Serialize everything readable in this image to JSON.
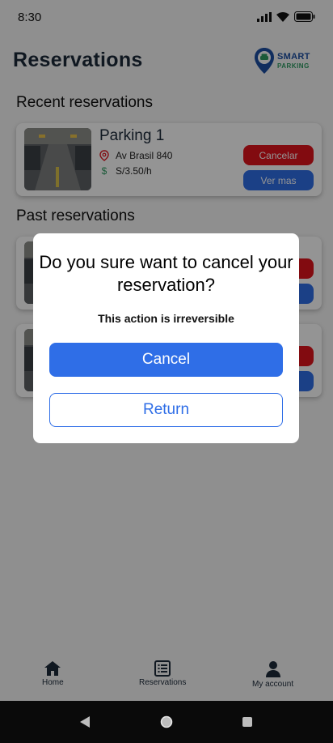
{
  "status": {
    "time": "8:30"
  },
  "header": {
    "title": "Reservations"
  },
  "logo": {
    "line1": "SMART",
    "line2": "PARKING"
  },
  "recent": {
    "title": "Recent reservations",
    "card": {
      "name": "Parking 1",
      "address": "Av Brasil 840",
      "price": "S/3.50/h",
      "cancel_label": "Cancelar",
      "more_label": "Ver mas"
    }
  },
  "past": {
    "title": "Past reservations"
  },
  "dialog": {
    "title": "Do you sure want to cancel your reservation?",
    "subtitle": "This action is irreversible",
    "confirm_label": "Cancel",
    "return_label": "Return"
  },
  "nav": {
    "items": [
      {
        "label": "Home",
        "icon": "home-icon"
      },
      {
        "label": "Reservations",
        "icon": "list-icon"
      },
      {
        "label": "My account",
        "icon": "account-icon"
      }
    ]
  },
  "colors": {
    "primary": "#2f6ee7",
    "danger": "#e0141c",
    "brand_green": "#2f9b63",
    "brand_blue": "#1c4fa3"
  }
}
